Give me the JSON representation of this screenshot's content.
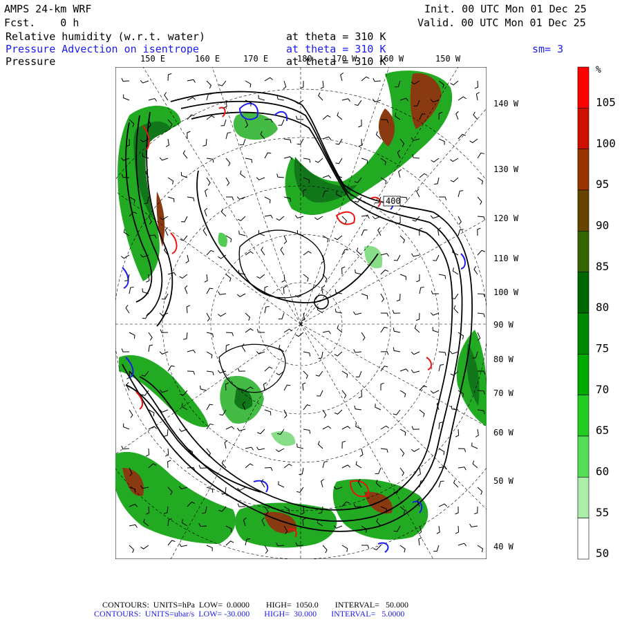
{
  "header": {
    "model": "AMPS 24-km WRF",
    "fcst": "Fcst.    0 h",
    "init": "Init. 00 UTC Mon 01 Dec 25",
    "valid": "Valid. 00 UTC Mon 01 Dec 25",
    "field1": "Relative humidity (w.r.t. water)",
    "field1_level": "at theta = 310 K",
    "field2": "Pressure Advection on isentrope",
    "field2_level": "at theta = 310 K",
    "field2_smooth": "sm= 3",
    "field3": "Pressure",
    "field3_level": "at theta = 310 K"
  },
  "map": {
    "lon_labels_top": [
      "150 E",
      "160 E",
      "170 E",
      "180",
      "170 W",
      "160 W",
      "150 W"
    ],
    "lon_labels_right": [
      "140 W",
      "130 W",
      "120 W",
      "110 W",
      "100 W",
      "90 W",
      "80 W",
      "70 W",
      "60 W",
      "50 W",
      "40 W"
    ],
    "contour_label": "400",
    "colors": {
      "pressure_contour": "#000000",
      "advection_positive": "#ee1111",
      "advection_negative": "#1a1aee"
    }
  },
  "colorbar": {
    "unit": "%",
    "labels": [
      "105",
      "100",
      "95",
      "90",
      "85",
      "80",
      "75",
      "70",
      "65",
      "60",
      "55",
      "50"
    ],
    "colors": [
      "#ff0000",
      "#cc1100",
      "#993300",
      "#664400",
      "#336600",
      "#006600",
      "#008800",
      "#00aa00",
      "#22cc22",
      "#55dd55",
      "#aaeeaa",
      "#ffffff"
    ]
  },
  "footer": {
    "line1": "CONTOURS:  UNITS=hPa  LOW=  0.0000        HIGH=  1050.0        INTERVAL=   50.000",
    "line2": "CONTOURS:  UNITS=ubar/s  LOW= -30.000       HIGH=  30.000       INTERVAL=   5.0000"
  }
}
